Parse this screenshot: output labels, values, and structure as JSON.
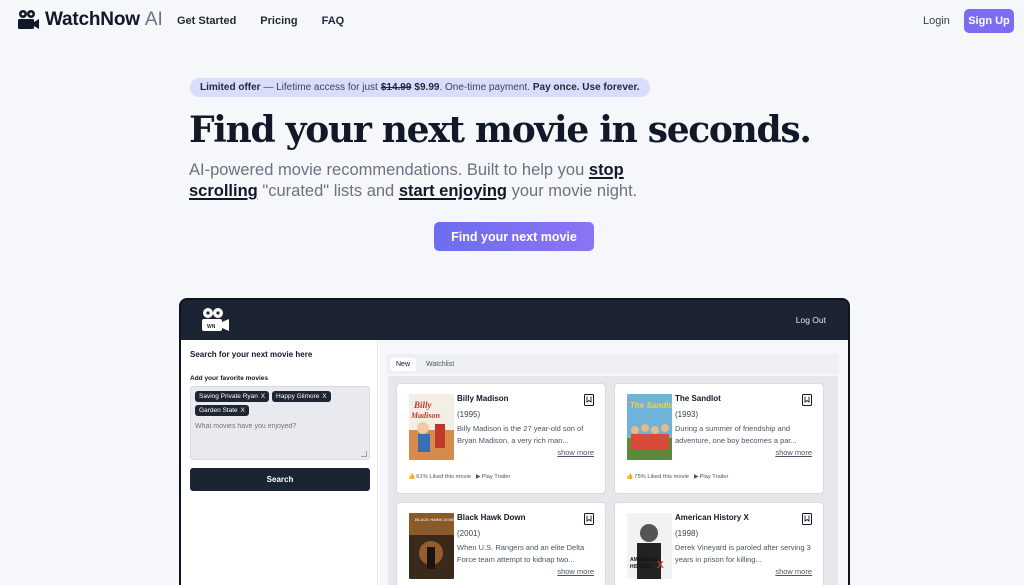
{
  "brand": {
    "name": "WatchNow",
    "suffix": "AI"
  },
  "nav": {
    "links": [
      "Get Started",
      "Pricing",
      "FAQ"
    ],
    "login": "Login",
    "signup": "Sign Up"
  },
  "hero": {
    "offer": {
      "label": "Limited offer",
      "text": "— Lifetime access for just",
      "old_price": "$14.99",
      "new_price": "$9.99",
      "tail": "One-time payment.",
      "bold_tail": "Pay once. Use forever."
    },
    "headline": "Find your next movie in seconds.",
    "sub": {
      "p1": "AI-powered movie recommendations. Built to help you",
      "u1": "stop scrolling",
      "p2": "\"curated\" lists and",
      "u2": "start enjoying",
      "p3": "your movie night."
    },
    "cta": "Find your next movie"
  },
  "app": {
    "logout": "Log Out",
    "sidebar": {
      "title": "Search for your next movie here",
      "label": "Add your favorite movies",
      "chips": [
        "Saving Private Ryan",
        "Happy Gilmore",
        "Garden State"
      ],
      "chip_x": "X",
      "placeholder": "What movies have you enjoyed?",
      "search": "Search"
    },
    "tabs": [
      "New",
      "Watchlist"
    ],
    "cards": [
      {
        "title": "Billy Madison",
        "year": "(1995)",
        "desc": "Billy Madison is the 27 year-old son of Bryan Madison, a very rich man...",
        "show_more": "show more",
        "liked": "61% Liked this movie",
        "trailer": "Play Trailer"
      },
      {
        "title": "The Sandlot",
        "year": "(1993)",
        "desc": "During a summer of friendship and adventure, one boy becomes a par...",
        "show_more": "show more",
        "liked": "75% Liked this movie",
        "trailer": "Play Trailer"
      },
      {
        "title": "Black Hawk Down",
        "year": "(2001)",
        "desc": "When U.S. Rangers and an elite Delta Force team attempt to kidnap two...",
        "show_more": "show more"
      },
      {
        "title": "American History X",
        "year": "(1998)",
        "desc": "Derek Vineyard is paroled after serving 3 years in prison for killing...",
        "show_more": "show more"
      }
    ]
  },
  "colors": {
    "accent": "#7c6cf2",
    "dark": "#1c2333",
    "offer_bg": "#d9dcfb"
  }
}
